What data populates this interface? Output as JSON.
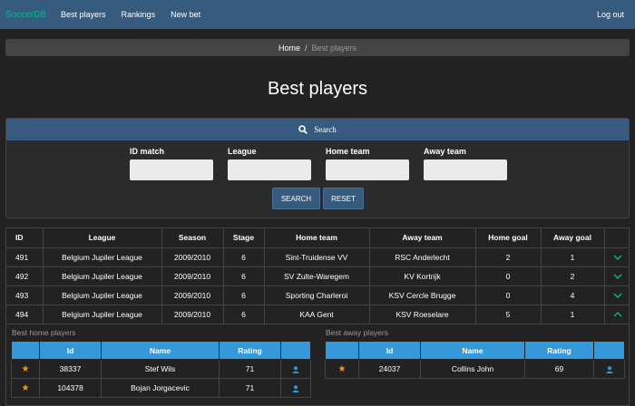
{
  "nav": {
    "brand": "SoccerDB",
    "links": [
      "Best players",
      "Rankings",
      "New bet"
    ],
    "logout": "Log out"
  },
  "breadcrumb": {
    "home": "Home",
    "separator": "/",
    "current": "Best players"
  },
  "page_title": "Best players",
  "search": {
    "title": "Search",
    "fields": [
      {
        "label": "ID match",
        "value": ""
      },
      {
        "label": "League",
        "value": ""
      },
      {
        "label": "Home team",
        "value": ""
      },
      {
        "label": "Away team",
        "value": ""
      }
    ],
    "search_label": "SEARCH",
    "reset_label": "RESET"
  },
  "matches": {
    "columns": [
      "ID",
      "League",
      "Season",
      "Stage",
      "Home team",
      "Away team",
      "Home goal",
      "Away goal"
    ],
    "rows": [
      {
        "id": "491",
        "league": "Belgium Jupiler League",
        "season": "2009/2010",
        "stage": "6",
        "home": "Sint-Truidense VV",
        "away": "RSC Anderlecht",
        "home_goal": "2",
        "away_goal": "1",
        "chevron": "chevron-down-icon"
      },
      {
        "id": "492",
        "league": "Belgium Jupiler League",
        "season": "2009/2010",
        "stage": "6",
        "home": "SV Zulte-Waregem",
        "away": "KV Kortrijk",
        "home_goal": "0",
        "away_goal": "2",
        "chevron": "chevron-down-icon"
      },
      {
        "id": "493",
        "league": "Belgium Jupiler League",
        "season": "2009/2010",
        "stage": "6",
        "home": "Sporting Charleroi",
        "away": "KSV Cercle Brugge",
        "home_goal": "0",
        "away_goal": "4",
        "chevron": "chevron-down-icon"
      },
      {
        "id": "494",
        "league": "Belgium Jupiler League",
        "season": "2009/2010",
        "stage": "6",
        "home": "KAA Gent",
        "away": "KSV Roeselare",
        "home_goal": "5",
        "away_goal": "1",
        "chevron": "chevron-up-icon"
      }
    ]
  },
  "best_home": {
    "title": "Best home players",
    "columns": [
      "",
      "Id",
      "Name",
      "Rating",
      ""
    ],
    "rows": [
      {
        "id": "38337",
        "name": "Stef Wils",
        "rating": "71"
      },
      {
        "id": "104378",
        "name": "Bojan Jorgacevic",
        "rating": "71"
      }
    ]
  },
  "best_away": {
    "title": "Best away players",
    "columns": [
      "",
      "Id",
      "Name",
      "Rating",
      ""
    ],
    "rows": [
      {
        "id": "24037",
        "name": "Collins John",
        "rating": "69"
      }
    ]
  },
  "colors": {
    "primary": "#375a7f",
    "success": "#00bc8c",
    "info": "#3498db",
    "warning": "#f39c12",
    "bg": "#222222"
  }
}
